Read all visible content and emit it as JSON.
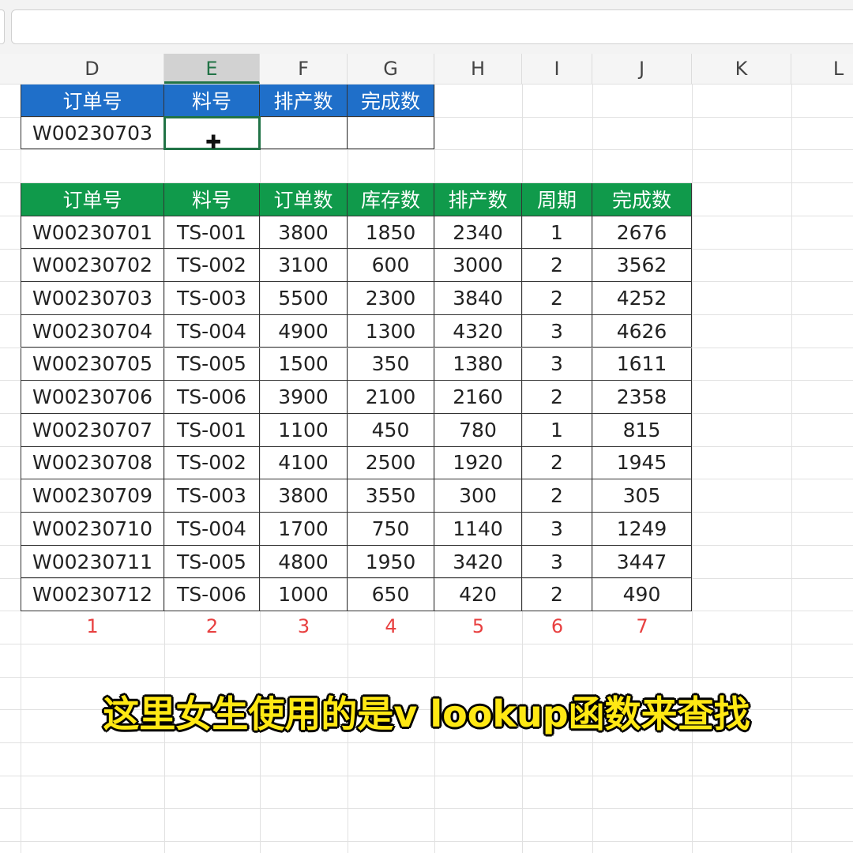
{
  "columns": [
    "D",
    "E",
    "F",
    "G",
    "H",
    "I",
    "J",
    "K",
    "L"
  ],
  "lookup_table": {
    "headers": [
      "订单号",
      "料号",
      "排产数",
      "完成数"
    ],
    "row": [
      "W00230703",
      "",
      "",
      ""
    ]
  },
  "data_table": {
    "headers": [
      "订单号",
      "料号",
      "订单数",
      "库存数",
      "排产数",
      "周期",
      "完成数"
    ],
    "rows": [
      [
        "W00230701",
        "TS-001",
        "3800",
        "1850",
        "2340",
        "1",
        "2676"
      ],
      [
        "W00230702",
        "TS-002",
        "3100",
        "600",
        "3000",
        "2",
        "3562"
      ],
      [
        "W00230703",
        "TS-003",
        "5500",
        "2300",
        "3840",
        "2",
        "4252"
      ],
      [
        "W00230704",
        "TS-004",
        "4900",
        "1300",
        "4320",
        "3",
        "4626"
      ],
      [
        "W00230705",
        "TS-005",
        "1500",
        "350",
        "1380",
        "3",
        "1611"
      ],
      [
        "W00230706",
        "TS-006",
        "3900",
        "2100",
        "2160",
        "2",
        "2358"
      ],
      [
        "W00230707",
        "TS-001",
        "1100",
        "450",
        "780",
        "1",
        "815"
      ],
      [
        "W00230708",
        "TS-002",
        "4100",
        "2500",
        "1920",
        "2",
        "1945"
      ],
      [
        "W00230709",
        "TS-003",
        "3800",
        "3550",
        "300",
        "2",
        "305"
      ],
      [
        "W00230710",
        "TS-004",
        "1700",
        "750",
        "1140",
        "3",
        "1249"
      ],
      [
        "W00230711",
        "TS-005",
        "4800",
        "1950",
        "3420",
        "3",
        "3447"
      ],
      [
        "W00230712",
        "TS-006",
        "1000",
        "650",
        "420",
        "2",
        "490"
      ]
    ]
  },
  "column_numbers": [
    "1",
    "2",
    "3",
    "4",
    "5",
    "6",
    "7"
  ],
  "subtitle": "这里女生使用的是v lookup函数来查找",
  "colors": {
    "blue_header": "#1f6fc9",
    "green_header": "#109a4b",
    "index_red": "#e84040",
    "subtitle_yellow": "#ffe814"
  },
  "icons": {
    "cursor": "cell-select-cursor-icon"
  }
}
